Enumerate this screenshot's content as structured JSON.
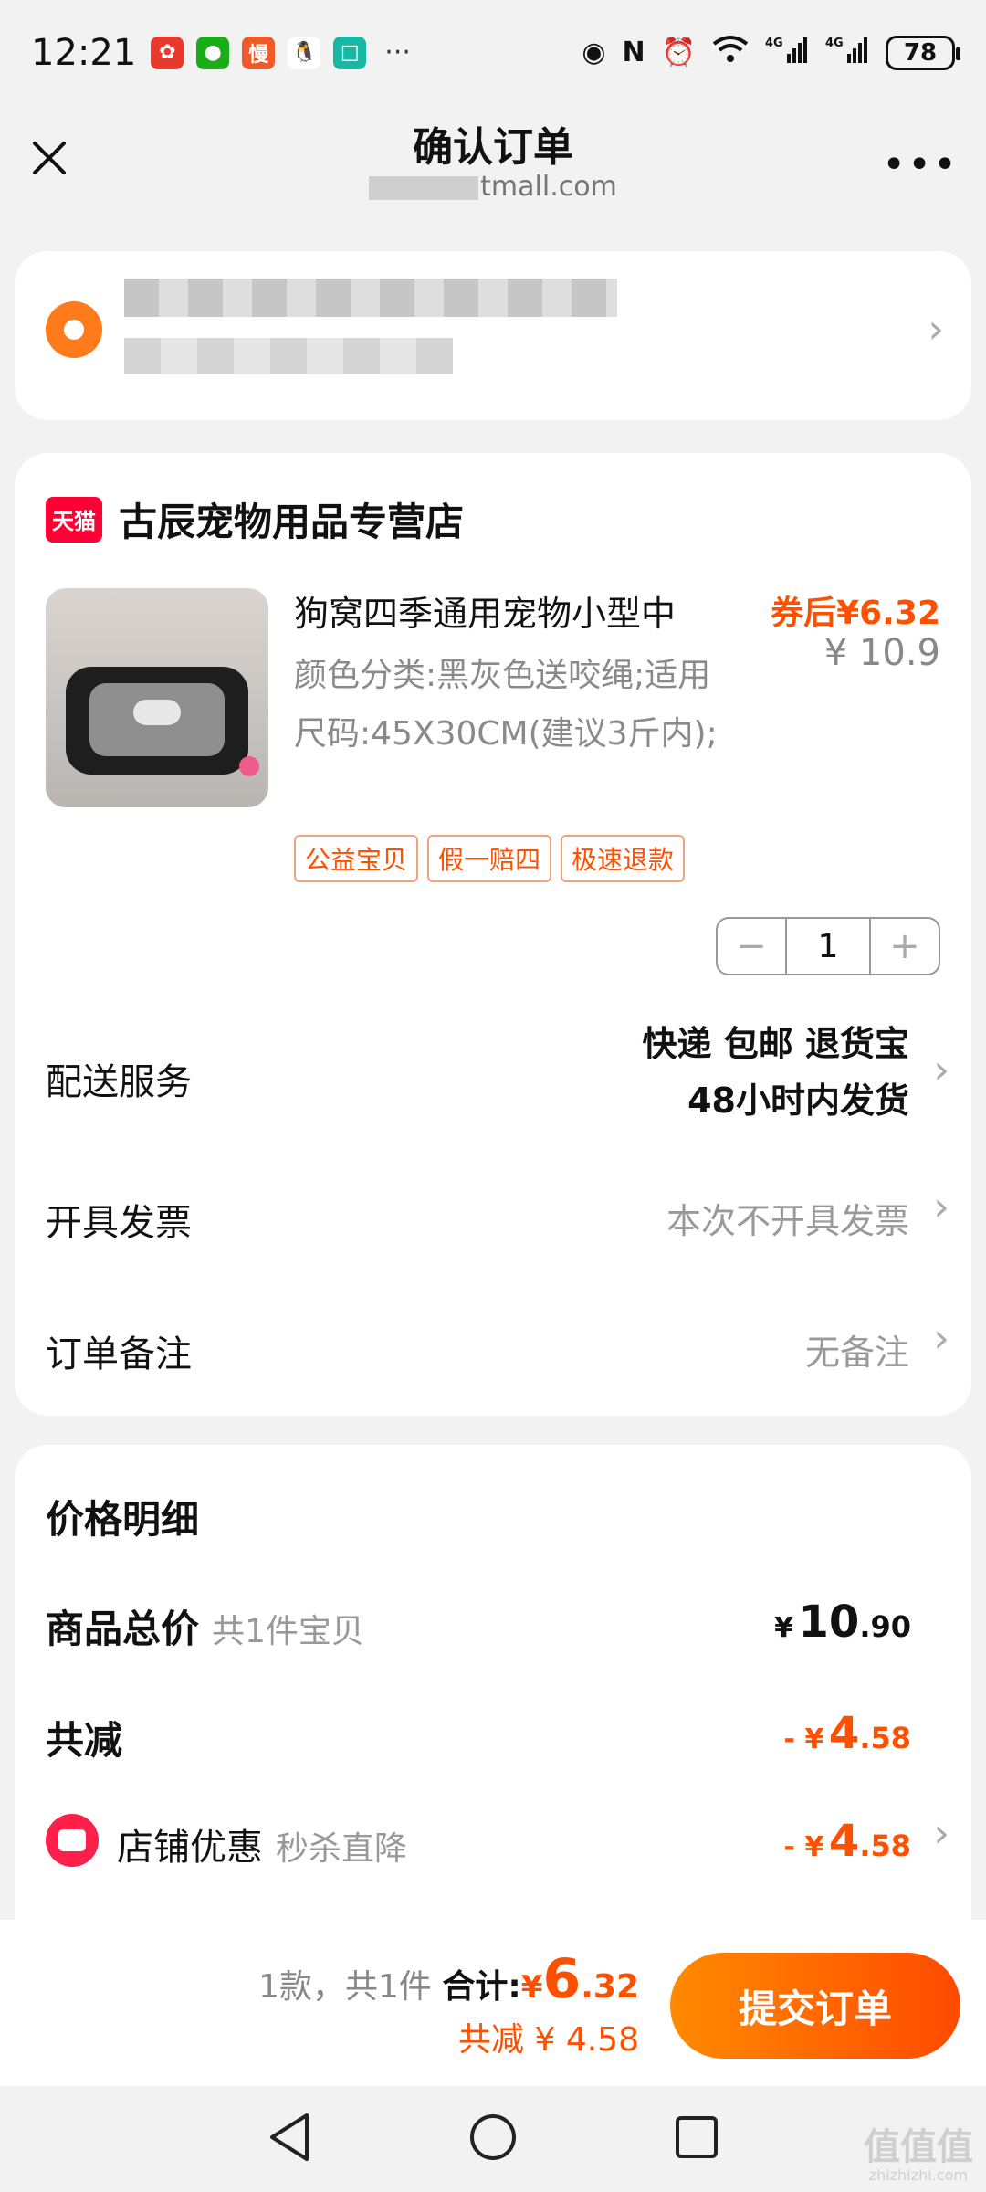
{
  "status_bar": {
    "time": "12:21",
    "notification_icons": [
      "xiaohongshu-icon",
      "wechat-icon",
      "app-man-icon",
      "qq-icon",
      "mi-icon"
    ],
    "more": "···",
    "system_icons": [
      "eye-icon",
      "nfc-icon",
      "alarm-icon",
      "wifi-icon",
      "4g-signal-icon",
      "4g-signal-icon"
    ],
    "battery": "78"
  },
  "nav": {
    "title": "确认订单",
    "subtitle": "tmall.com",
    "more": "•••"
  },
  "shop": {
    "badge": "天猫",
    "name": "古辰宠物用品专营店"
  },
  "product": {
    "title": "狗窝四季通用宠物小型中",
    "spec": "颜色分类:黑灰色送咬绳;适用尺码:45X30CM(建议3斤内);",
    "price_after_coupon": "券后¥6.32",
    "original_price": "¥ 10.9",
    "tags": [
      "公益宝贝",
      "假一赔四",
      "极速退款"
    ],
    "quantity": "1",
    "minus": "−",
    "plus": "+"
  },
  "delivery": {
    "label": "配送服务",
    "line1": "快递 包邮 退货宝",
    "line2": "48小时内发货"
  },
  "invoice": {
    "label": "开具发票",
    "value": "本次不开具发票"
  },
  "remark": {
    "label": "订单备注",
    "value": "无备注"
  },
  "price_detail": {
    "header": "价格明细",
    "total_label": "商品总价",
    "total_sub": "共1件宝贝",
    "total_yen": "¥",
    "total_int": "10",
    "total_dec": ".90",
    "reduce_label": "共减",
    "reduce_prefix": "- ¥",
    "reduce_int": "4",
    "reduce_dec": ".58",
    "shop_discount_label": "店铺优惠",
    "shop_discount_sub": "秒杀直降",
    "shop_discount_prefix": "- ¥",
    "shop_discount_int": "4",
    "shop_discount_dec": ".58"
  },
  "submit_bar": {
    "count_text": "1款，共1件",
    "total_label": "合计:",
    "total_yen": "¥",
    "total_int": "6",
    "total_dec": ".32",
    "reduce_text": "共减 ¥ 4.58",
    "submit": "提交订单"
  },
  "watermark": {
    "text": "值值值",
    "sub": "zhizhizhi.com"
  },
  "colors": {
    "accent": "#ff5000",
    "tmall_red": "#ff0036",
    "submit_gradient_start": "#ff8a00",
    "submit_gradient_end": "#ff4a00"
  }
}
